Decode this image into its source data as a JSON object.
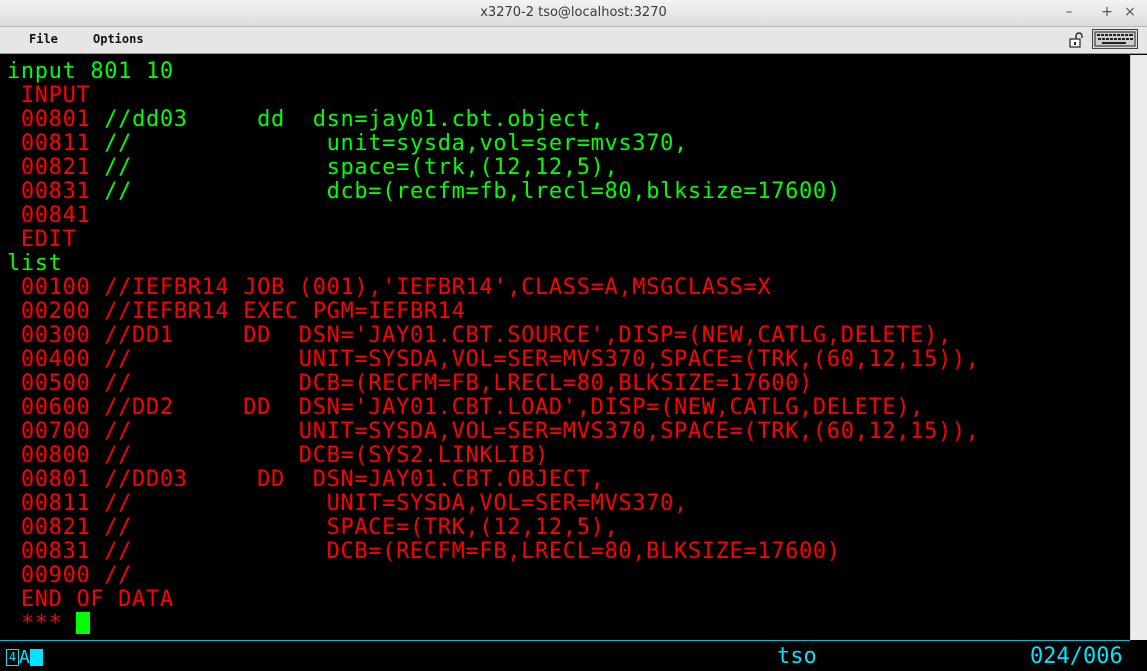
{
  "window": {
    "title": "x3270-2 tso@localhost:3270",
    "minimize": "–",
    "maximize": "+",
    "close": "×"
  },
  "menu": {
    "file": "File",
    "options": "Options"
  },
  "icons": {
    "lock": "lock-icon",
    "keyboard": "keyboard-icon"
  },
  "colors": {
    "green": "#00ff00",
    "red": "#ff0000",
    "cyan": "#00e5ff",
    "background": "#000000"
  },
  "terminal": {
    "lines": [
      {
        "text": "input 801 10",
        "color": "green"
      },
      {
        "text": " INPUT",
        "color": "red"
      },
      {
        "seg": [
          {
            "text": " 00801 ",
            "color": "red"
          },
          {
            "text": "//dd03     dd  dsn=jay01.cbt.object,",
            "color": "green"
          }
        ]
      },
      {
        "seg": [
          {
            "text": " 00811 ",
            "color": "red"
          },
          {
            "text": "//              unit=sysda,vol=ser=mvs370,",
            "color": "green"
          }
        ]
      },
      {
        "seg": [
          {
            "text": " 00821 ",
            "color": "red"
          },
          {
            "text": "//              space=(trk,(12,12,5),",
            "color": "green"
          }
        ]
      },
      {
        "seg": [
          {
            "text": " 00831 ",
            "color": "red"
          },
          {
            "text": "//              dcb=(recfm=fb,lrecl=80,blksize=17600)",
            "color": "green"
          }
        ]
      },
      {
        "text": " 00841",
        "color": "red"
      },
      {
        "text": " EDIT",
        "color": "red"
      },
      {
        "text": "list",
        "color": "green"
      },
      {
        "text": " 00100 //IEFBR14 JOB (001),'IEFBR14',CLASS=A,MSGCLASS=X",
        "color": "red"
      },
      {
        "text": " 00200 //IEFBR14 EXEC PGM=IEFBR14",
        "color": "red"
      },
      {
        "text": " 00300 //DD1     DD  DSN='JAY01.CBT.SOURCE',DISP=(NEW,CATLG,DELETE),",
        "color": "red"
      },
      {
        "text": " 00400 //            UNIT=SYSDA,VOL=SER=MVS370,SPACE=(TRK,(60,12,15)),",
        "color": "red"
      },
      {
        "text": " 00500 //            DCB=(RECFM=FB,LRECL=80,BLKSIZE=17600)",
        "color": "red"
      },
      {
        "text": " 00600 //DD2     DD  DSN='JAY01.CBT.LOAD',DISP=(NEW,CATLG,DELETE),",
        "color": "red"
      },
      {
        "text": " 00700 //            UNIT=SYSDA,VOL=SER=MVS370,SPACE=(TRK,(60,12,15)),",
        "color": "red"
      },
      {
        "text": " 00800 //            DCB=(SYS2.LINKLIB)",
        "color": "red"
      },
      {
        "text": " 00801 //DD03     DD  DSN=JAY01.CBT.OBJECT,",
        "color": "red"
      },
      {
        "text": " 00811 //              UNIT=SYSDA,VOL=SER=MVS370,",
        "color": "red"
      },
      {
        "text": " 00821 //              SPACE=(TRK,(12,12,5),",
        "color": "red"
      },
      {
        "text": " 00831 //              DCB=(RECFM=FB,LRECL=80,BLKSIZE=17600)",
        "color": "red"
      },
      {
        "text": " 00900 //",
        "color": "red"
      },
      {
        "text": " END OF DATA",
        "color": "red"
      },
      {
        "text": " *** ",
        "color": "red",
        "cursor": true
      }
    ]
  },
  "status": {
    "indicator_box": "4",
    "indicator_a": "A",
    "host": "tso",
    "position": "024/006"
  }
}
